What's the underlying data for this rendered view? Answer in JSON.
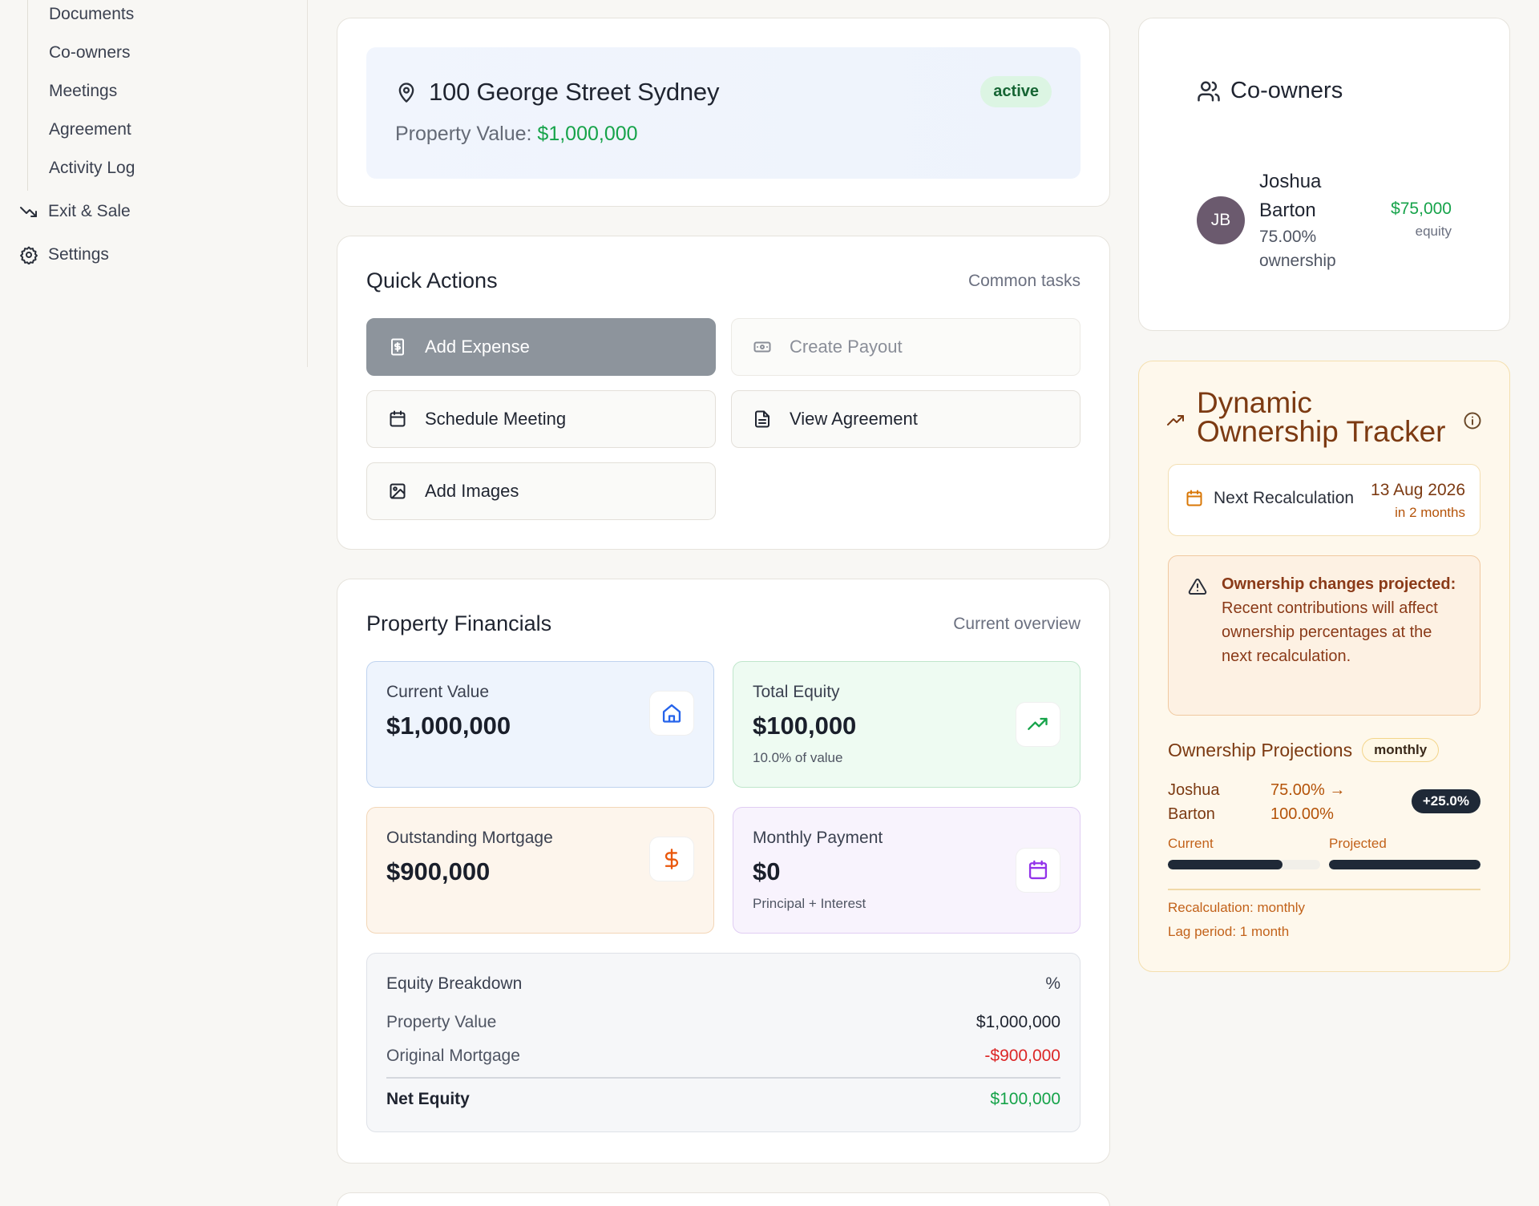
{
  "sidebar": {
    "sub_items": [
      "Documents",
      "Co-owners",
      "Meetings",
      "Agreement",
      "Activity Log"
    ],
    "exit_sale": "Exit & Sale",
    "settings": "Settings"
  },
  "property": {
    "address": "100 George Street Sydney",
    "value_label": "Property Value:",
    "value": "$1,000,000",
    "status": "active"
  },
  "quick_actions": {
    "title": "Quick Actions",
    "subtitle": "Common tasks",
    "add_expense": "Add Expense",
    "create_payout": "Create Payout",
    "schedule_meeting": "Schedule Meeting",
    "view_agreement": "View Agreement",
    "add_images": "Add Images"
  },
  "financials": {
    "title": "Property Financials",
    "subtitle": "Current overview",
    "current_value": {
      "label": "Current Value",
      "value": "$1,000,000"
    },
    "total_equity": {
      "label": "Total Equity",
      "value": "$100,000",
      "sub": "10.0% of value"
    },
    "outstanding_mortgage": {
      "label": "Outstanding Mortgage",
      "value": "$900,000"
    },
    "monthly_payment": {
      "label": "Monthly Payment",
      "value": "$0",
      "sub": "Principal + Interest"
    },
    "breakdown": {
      "title": "Equity Breakdown",
      "percent_icon": "%",
      "property_value_label": "Property Value",
      "property_value": "$1,000,000",
      "mortgage_label": "Original Mortgage",
      "mortgage": "-$900,000",
      "net_label": "Net Equity",
      "net": "$100,000"
    }
  },
  "coowners": {
    "title": "Co-owners",
    "owner": {
      "initials": "JB",
      "name": "Joshua Barton",
      "ownership": "75.00% ownership",
      "equity": "$75,000",
      "equity_label": "equity"
    }
  },
  "tracker": {
    "title": "Dynamic Ownership Tracker",
    "next_label": "Next Recalculation",
    "next_date": "13 Aug 2026",
    "next_relative": "in 2 months",
    "warning_bold": "Ownership changes projected:",
    "warning_text": " Recent contributions will affect ownership percentages at the next recalculation.",
    "projections_title": "Ownership Projections",
    "frequency": "monthly",
    "projection": {
      "name": "Joshua Barton",
      "change": "75.00% → 100.00%",
      "delta": "+25.0%",
      "current_label": "Current",
      "projected_label": "Projected",
      "current_fraction": 0.75,
      "projected_fraction": 1.0
    },
    "recalc_text": "Recalculation: monthly",
    "lag_text": "Lag period: 1 month"
  },
  "colors": {
    "green": "#16a34a",
    "red": "#dc2626",
    "primary_button": "#8d949c",
    "tracker_brown": "#7c3a12"
  }
}
